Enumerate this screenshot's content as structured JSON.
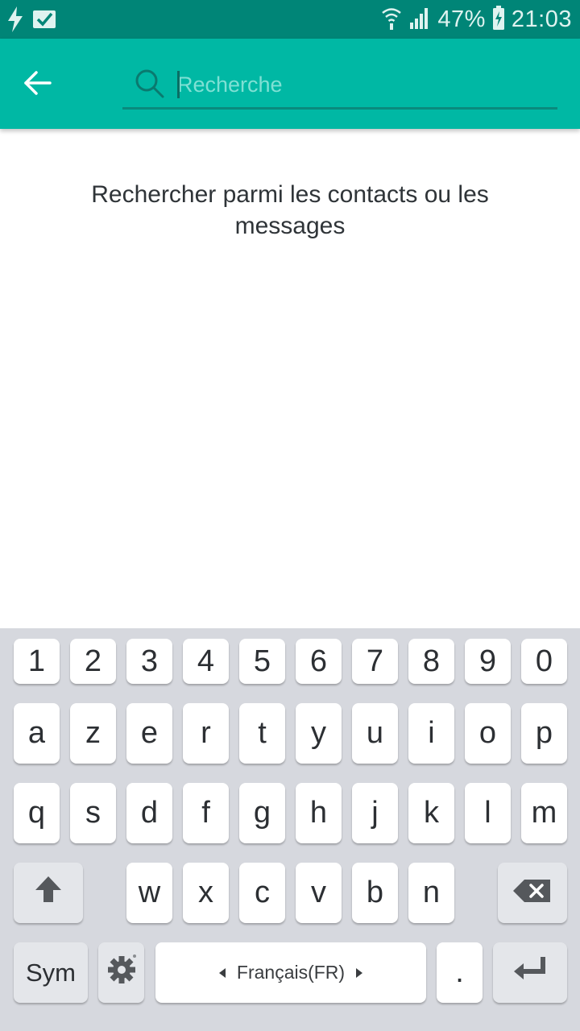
{
  "status_bar": {
    "battery_percent": "47%",
    "time": "21:03",
    "icons": [
      "flash-icon",
      "checkbox-notification-icon",
      "wifi-icon",
      "signal-icon",
      "battery-charging-icon"
    ]
  },
  "app_bar": {
    "back_icon": "arrow-left-icon",
    "search": {
      "placeholder": "Recherche",
      "value": ""
    }
  },
  "content": {
    "hint": "Rechercher parmi les contacts ou les messages"
  },
  "keyboard": {
    "numbers": [
      "1",
      "2",
      "3",
      "4",
      "5",
      "6",
      "7",
      "8",
      "9",
      "0"
    ],
    "row1": [
      "a",
      "z",
      "e",
      "r",
      "t",
      "y",
      "u",
      "i",
      "o",
      "p"
    ],
    "row2": [
      "q",
      "s",
      "d",
      "f",
      "g",
      "h",
      "j",
      "k",
      "l",
      "m"
    ],
    "row3": [
      "w",
      "x",
      "c",
      "v",
      "b",
      "n"
    ],
    "sym_label": "Sym",
    "space_label": "Français(FR)",
    "period_label": "."
  },
  "colors": {
    "status_bar": "#008577",
    "app_bar": "#00b8a4",
    "keyboard_bg": "#d6d8de"
  }
}
